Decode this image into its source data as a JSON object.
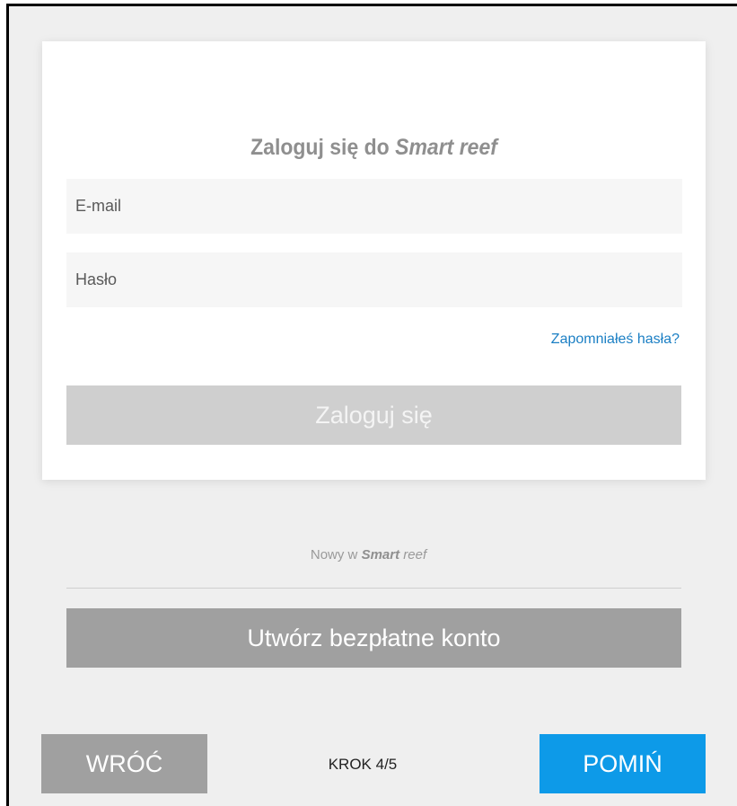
{
  "login_card": {
    "title_prefix": "Zaloguj się do ",
    "title_brand": "Smart reef",
    "email_placeholder": "E-mail",
    "password_placeholder": "Hasło",
    "forgot_password": "Zapomniałeś hasła?",
    "login_button": "Zaloguj się"
  },
  "signup": {
    "prompt_prefix": "Nowy w ",
    "prompt_brand_bold": "Smart",
    "prompt_brand_rest": " reef",
    "create_button": "Utwórz bezpłatne konto"
  },
  "footer": {
    "back_button": "WRÓĆ",
    "step_label": "KROK 4/5",
    "skip_button": "POMIŃ"
  },
  "colors": {
    "background": "#efefef",
    "card": "#ffffff",
    "link": "#1b7fc4",
    "disabled_button": "#cfcfcf",
    "secondary_button": "#a0a0a0",
    "primary_button": "#0d9ae8"
  }
}
